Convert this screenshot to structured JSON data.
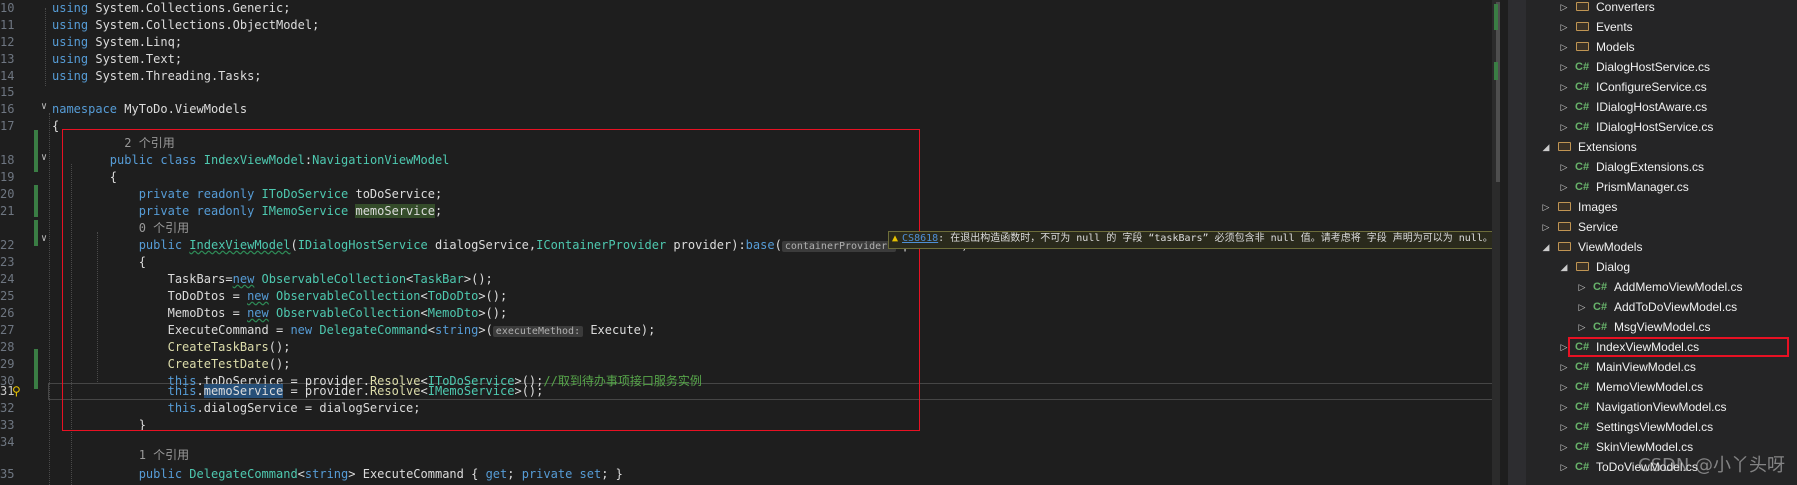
{
  "code": {
    "line_numbers": [
      "10",
      "11",
      "12",
      "13",
      "14",
      "15",
      "16",
      "17",
      "18",
      "19",
      "20",
      "21",
      "22",
      "23",
      "24",
      "25",
      "26",
      "27",
      "28",
      "29",
      "30",
      "31",
      "32",
      "33",
      "34",
      "35"
    ],
    "usings": [
      {
        "kw": "using",
        "ns": "System.Collections.Generic;"
      },
      {
        "kw": "using",
        "ns": "System.Collections.ObjectModel;"
      },
      {
        "kw": "using",
        "ns": "System.Linq;"
      },
      {
        "kw": "using",
        "ns": "System.Text;"
      },
      {
        "kw": "using",
        "ns": "System.Threading.Tasks;"
      }
    ],
    "namespace_kw": "namespace",
    "namespace_name": "MyToDo.ViewModels",
    "open_brace": "{",
    "close_brace": "}",
    "ref2": "2 个引用",
    "ref0": "0 个引用",
    "ref1": "1 个引用",
    "class_public": "public",
    "class_kw": "class",
    "class_name": "IndexViewModel",
    "class_colon": ":",
    "class_base": "NavigationViewModel",
    "private": "private",
    "readonly": "readonly",
    "todo_type": "IToDoService",
    "todo_field": "toDoService",
    "memo_type": "IMemoService",
    "memo_field": "memoService",
    "semicolon": ";",
    "ctor_name": "IndexViewModel",
    "paren_open": "(",
    "p1_type": "IDialogHostService",
    "p1_name": "dialogService",
    "comma": ",",
    "p2_type": "IContainerProvider",
    "p2_name": "provider",
    "paren_close": ")",
    "base_colon": ":",
    "base_kw": "base",
    "hint_container": "containerProvider:",
    "new_kw": "new",
    "observable": "ObservableCollection",
    "lt": "<",
    "gt": ">",
    "empty_args": "();",
    "taskbars": "TaskBars",
    "taskbar": "TaskBar",
    "todos": "ToDoDtos",
    "tododto": "ToDoDto",
    "memos": "MemoDtos",
    "memodto": "MemoDto",
    "assign": "=",
    "assign_sp": " = ",
    "exec_cmd": "ExecuteCommand",
    "delegate_cmd": "DelegateCommand",
    "string_kw": "string",
    "hint_exec": "executeMethod:",
    "execute": "Execute",
    "close_paren_semi": ");",
    "create_taskbars": "CreateTaskBars",
    "create_testdate": "CreateTestDate",
    "this_kw": "this",
    "dot": ".",
    "to_do_service": "toDoService",
    "memo_service": "memoService",
    "dialog_service": "dialogService",
    "provider": "provider",
    "resolve": "Resolve",
    "comment": "//取到待办事项接口服务实例",
    "public": "public",
    "get_kw": "get",
    "set_kw": "set",
    "prop_open": " { ",
    "prop_close": "; }",
    "semi_sp": "; "
  },
  "warning": {
    "code": "CS8618",
    "message": ": 在退出构造函数时，不可为 null 的 字段 “taskBars” 必须包含非 null 值。请考虑将 字段 声明为可以为 null。"
  },
  "tree": [
    {
      "label": "Converters",
      "type": "folder",
      "expander": "collapsed"
    },
    {
      "label": "Events",
      "type": "folder",
      "expander": "collapsed"
    },
    {
      "label": "Models",
      "type": "folder",
      "expander": "collapsed"
    },
    {
      "label": "DialogHostService.cs",
      "type": "cs",
      "expander": "collapsed"
    },
    {
      "label": "IConfigureService.cs",
      "type": "cs",
      "expander": "collapsed"
    },
    {
      "label": "IDialogHostAware.cs",
      "type": "cs",
      "expander": "collapsed"
    },
    {
      "label": "IDialogHostService.cs",
      "type": "cs",
      "expander": "collapsed"
    },
    {
      "label": "Extensions",
      "type": "folder",
      "expander": "expanded"
    },
    {
      "label": "DialogExtensions.cs",
      "type": "cs",
      "expander": "collapsed"
    },
    {
      "label": "PrismManager.cs",
      "type": "cs",
      "expander": "collapsed"
    },
    {
      "label": "Images",
      "type": "folder",
      "expander": "collapsed"
    },
    {
      "label": "Service",
      "type": "folder",
      "expander": "collapsed"
    },
    {
      "label": "ViewModels",
      "type": "folder",
      "expander": "expanded"
    },
    {
      "label": "Dialog",
      "type": "folder",
      "expander": "expanded"
    },
    {
      "label": "AddMemoViewModel.cs",
      "type": "cs",
      "expander": "collapsed"
    },
    {
      "label": "AddToDoViewModel.cs",
      "type": "cs",
      "expander": "collapsed"
    },
    {
      "label": "MsgViewModel.cs",
      "type": "cs",
      "expander": "collapsed"
    },
    {
      "label": "IndexViewModel.cs",
      "type": "cs",
      "expander": "collapsed",
      "selected": true
    },
    {
      "label": "MainViewModel.cs",
      "type": "cs",
      "expander": "collapsed"
    },
    {
      "label": "MemoViewModel.cs",
      "type": "cs",
      "expander": "collapsed"
    },
    {
      "label": "NavigationViewModel.cs",
      "type": "cs",
      "expander": "collapsed"
    },
    {
      "label": "SettingsViewModel.cs",
      "type": "cs",
      "expander": "collapsed"
    },
    {
      "label": "SkinViewModel.cs",
      "type": "cs",
      "expander": "collapsed"
    },
    {
      "label": "ToDoViewModel.cs",
      "type": "cs",
      "expander": "collapsed"
    }
  ],
  "csharp_badge": "C#",
  "watermark": "CSDN @小丫头呀",
  "colors": {
    "highlight_box": "#e81123",
    "editor_bg": "#1e1e1e",
    "keyword": "#569cd6",
    "type": "#4ec9b0",
    "method": "#dcdcaa",
    "comment": "#57a64a"
  }
}
